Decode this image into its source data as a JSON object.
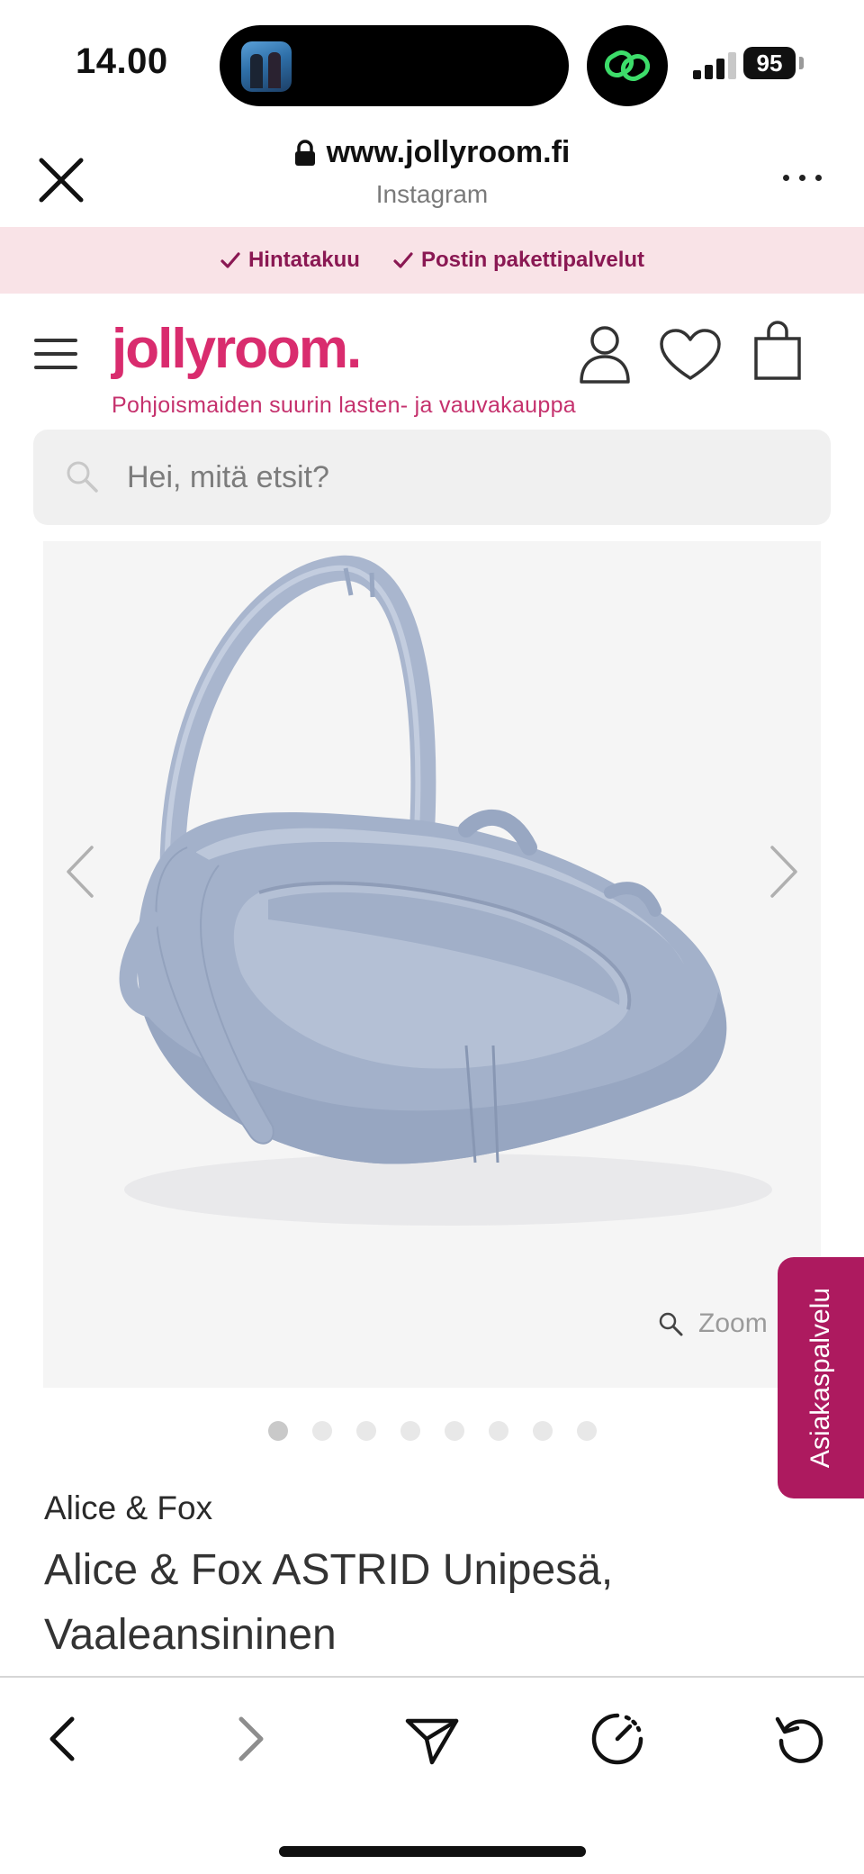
{
  "status_bar": {
    "time": "14.00",
    "battery": "95"
  },
  "browser": {
    "url": "www.jollyroom.fi",
    "source": "Instagram"
  },
  "trust_bar": {
    "items": [
      "Hintatakuu",
      "Postin pakettipalvelut"
    ]
  },
  "header": {
    "logo": "jollyroom.",
    "tagline": "Pohjoismaiden suurin lasten- ja vauvakauppa"
  },
  "search": {
    "placeholder": "Hei, mitä etsit?"
  },
  "gallery": {
    "zoom_label": "Zoom",
    "image_count": 8,
    "active_index": 0
  },
  "side_tab": {
    "label": "Asiakaspalvelu"
  },
  "product": {
    "brand": "Alice & Fox",
    "title": "Alice & Fox ASTRID Unipesä, Vaaleansininen"
  },
  "colors": {
    "brand_pink": "#d92c6e",
    "trust_bg": "#f9e3e7",
    "trust_text": "#8a1853",
    "side_tab": "#ad1a5f",
    "product_blue": "#a8b6cf"
  }
}
